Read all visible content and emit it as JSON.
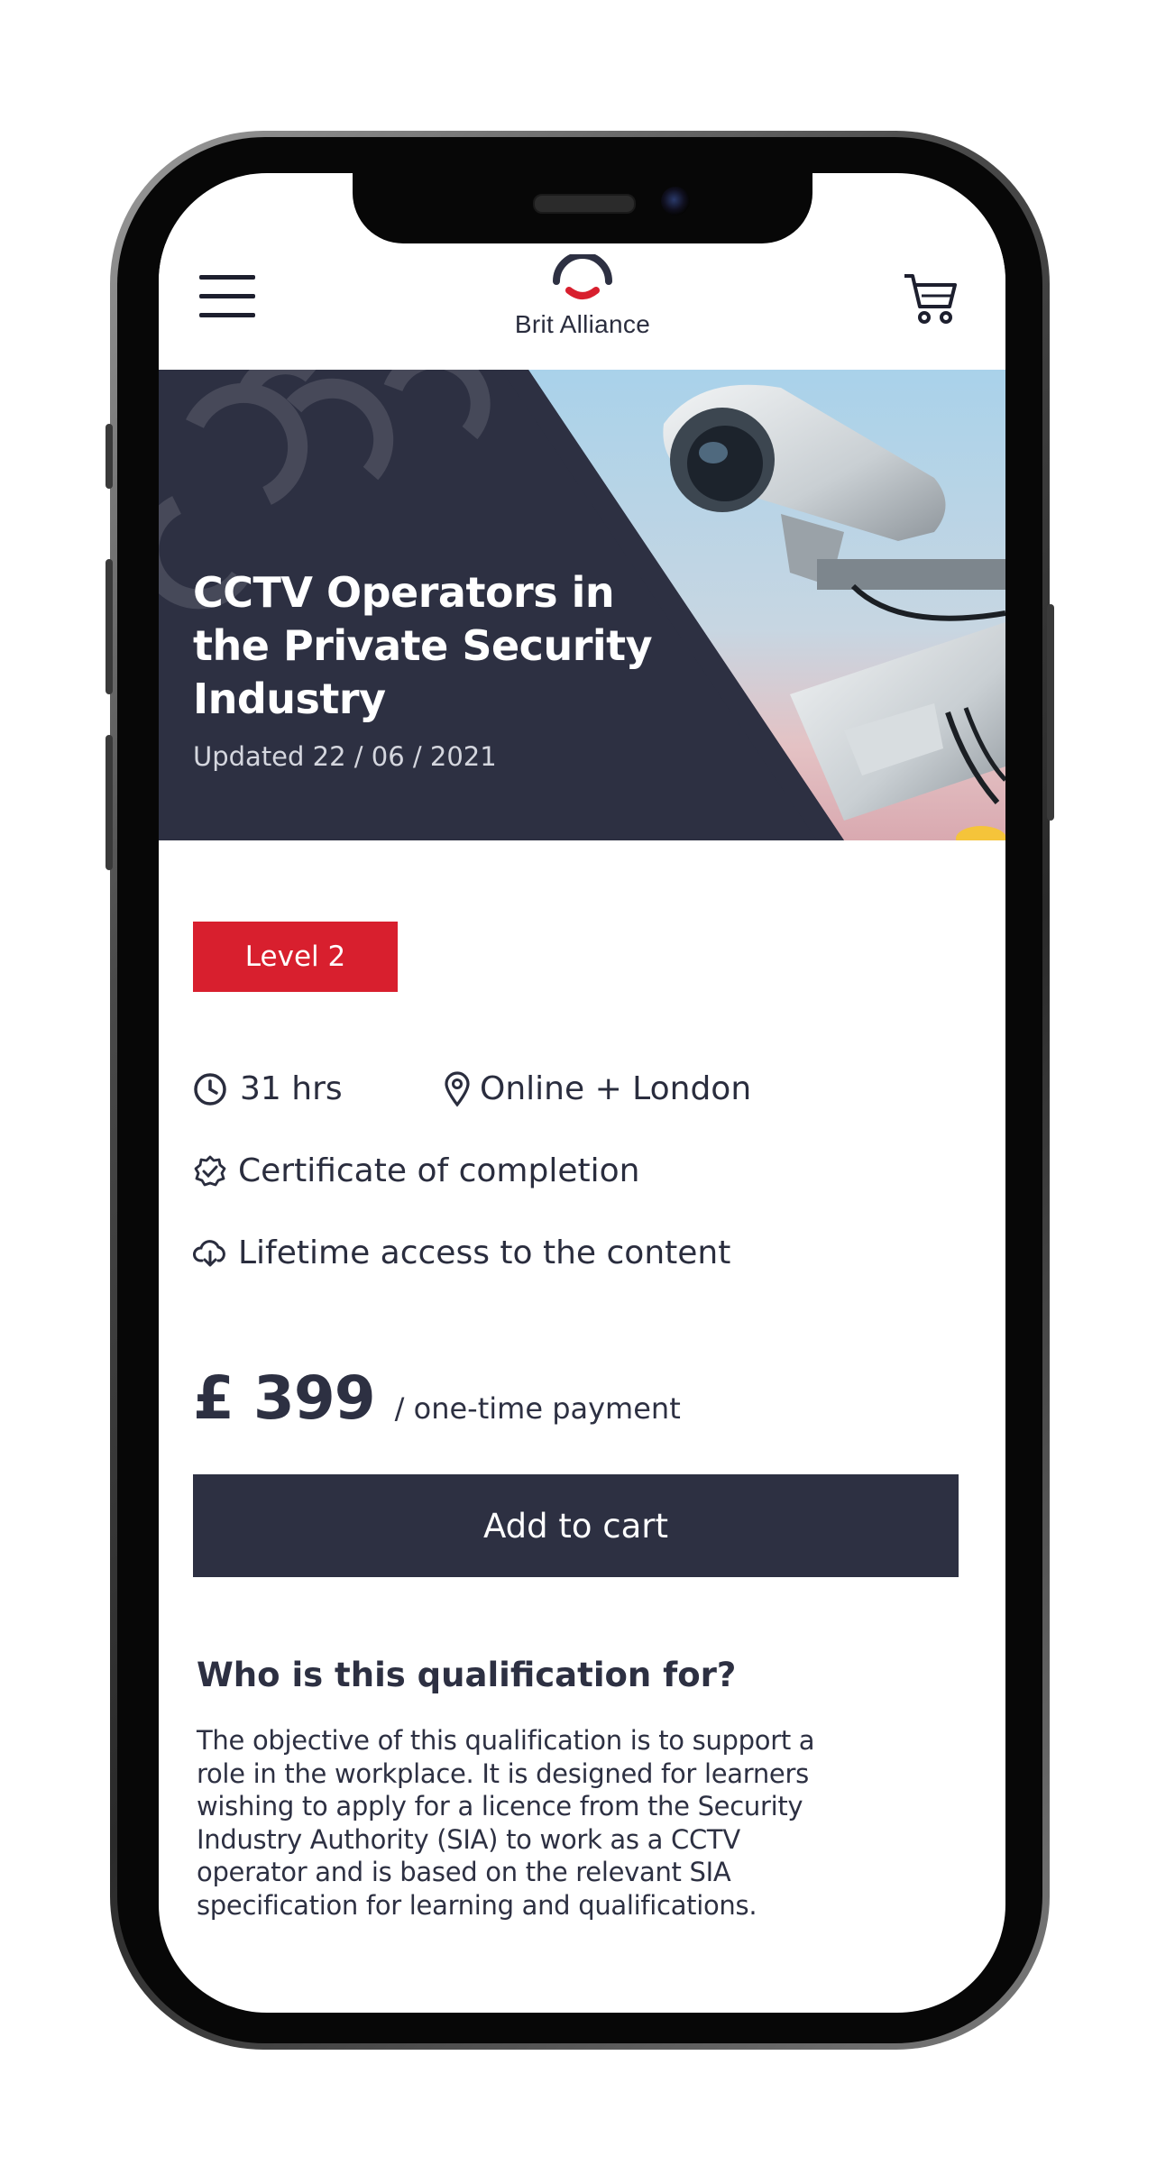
{
  "header": {
    "brand_name": "Brit Alliance"
  },
  "hero": {
    "title": "CCTV Operators in the Private Security Industry",
    "updated": "Updated 22 / 06 / 2021"
  },
  "course": {
    "level": "Level 2",
    "duration": "31 hrs",
    "location": "Online + London",
    "certificate": "Certificate of completion",
    "access": "Lifetime access to the content"
  },
  "pricing": {
    "price": "£ 399",
    "price_note": "/ one-time payment",
    "add_to_cart_label": "Add to cart"
  },
  "qualification": {
    "heading": "Who is this qualification for?",
    "body": "The objective of this qualification is to support a role in the workplace. It is designed for learners wishing to apply for a licence from the Security Industry Authority (SIA) to work as a CCTV operator and is based on the relevant SIA specification for learning and qualifications."
  },
  "icons": {
    "menu": "hamburger-menu-icon",
    "cart": "shopping-cart-icon",
    "duration": "clock-icon",
    "location": "location-pin-icon",
    "certificate": "badge-check-icon",
    "access": "cloud-download-icon"
  },
  "colors": {
    "brand_navy": "#2d3042",
    "badge_red": "#d81f2e",
    "text_dark": "#2a2d3e"
  }
}
